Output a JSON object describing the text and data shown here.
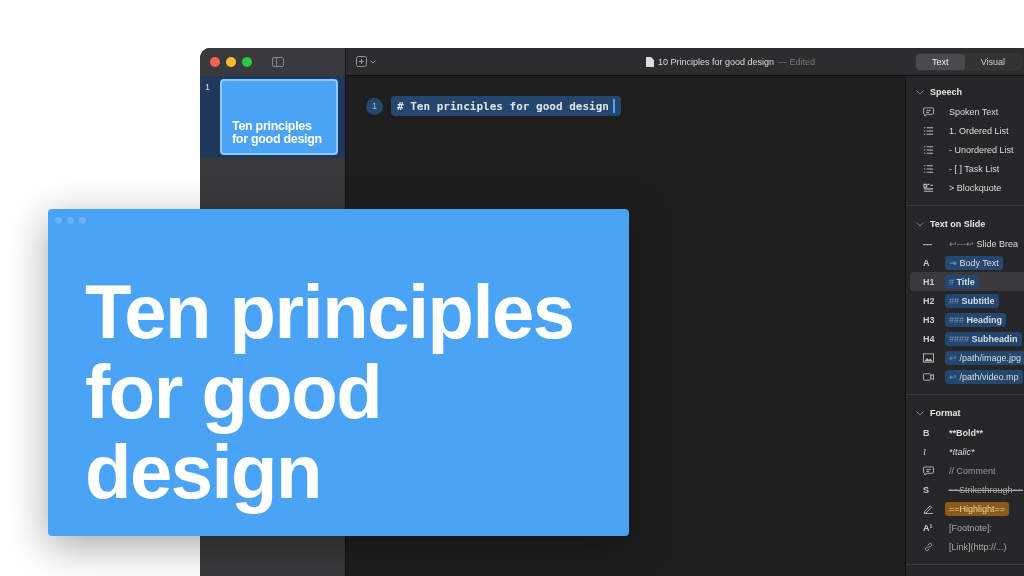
{
  "window": {
    "document_title": "10 Principles for good design",
    "status": "— Edited"
  },
  "view_tabs": [
    {
      "label": "Text",
      "selected": true
    },
    {
      "label": "Visual",
      "selected": false
    }
  ],
  "slides": [
    {
      "number": "1",
      "title": "Ten principles for good design",
      "selected": true
    }
  ],
  "editor": {
    "lines": [
      {
        "number": "1",
        "text": "# Ten principles for good design"
      }
    ]
  },
  "inspector": [
    {
      "title": "Speech",
      "expanded": true,
      "items": [
        {
          "kind": "bubble",
          "text": "Spoken Text",
          "selected": false
        },
        {
          "kind": "ordered",
          "text": "1. Ordered List",
          "selected": false
        },
        {
          "kind": "unordered",
          "text": "- Unordered List",
          "selected": false
        },
        {
          "kind": "task",
          "text": "- [ ] Task List",
          "selected": false
        },
        {
          "kind": "quote",
          "text": "> Blockquote",
          "selected": false
        }
      ]
    },
    {
      "title": "Text on Slide",
      "expanded": true,
      "items": [
        {
          "kind": "label",
          "marker": "---",
          "prefix": "↩---↩",
          "text": "Slide Brea",
          "chip": false,
          "selected": false
        },
        {
          "kind": "label",
          "marker": "A",
          "prefix": "⇥",
          "text": "Body Text",
          "chip": true,
          "selected": false
        },
        {
          "kind": "label",
          "marker": "H1",
          "prefix": "#",
          "text": "Title",
          "chip": true,
          "bold": true,
          "selected": true
        },
        {
          "kind": "label",
          "marker": "H2",
          "prefix": "##",
          "text": "Subtitle",
          "chip": true,
          "bold": true,
          "selected": false
        },
        {
          "kind": "label",
          "marker": "H3",
          "prefix": "###",
          "text": "Heading",
          "chip": true,
          "bold": true,
          "selected": false
        },
        {
          "kind": "label",
          "marker": "H4",
          "prefix": "####",
          "text": "Subheadin",
          "chip": true,
          "bold": true,
          "selected": false
        },
        {
          "kind": "image",
          "prefix": "↩",
          "text": "/path/image.jpg",
          "chip": true,
          "selected": false
        },
        {
          "kind": "video",
          "prefix": "↩",
          "text": "/path/video.mp",
          "chip": true,
          "selected": false
        }
      ]
    },
    {
      "title": "Format",
      "expanded": true,
      "items": [
        {
          "kind": "bold",
          "marker": "B",
          "text": "**Bold**",
          "selected": false
        },
        {
          "kind": "italic",
          "marker": "I",
          "text": "*Italic*",
          "selected": false
        },
        {
          "kind": "comment",
          "text": "// Comment",
          "selected": false
        },
        {
          "kind": "strike",
          "marker": "S",
          "text": "~~Strikethrough~~",
          "selected": false
        },
        {
          "kind": "highlight",
          "text": "==Highlight==",
          "selected": false
        },
        {
          "kind": "footnote",
          "marker": "A¹",
          "text": "[Footnote]:",
          "selected": false
        },
        {
          "kind": "link",
          "text": "[Link](http://...)",
          "selected": false
        }
      ]
    }
  ],
  "preview": {
    "title": "Ten principles for good design"
  }
}
